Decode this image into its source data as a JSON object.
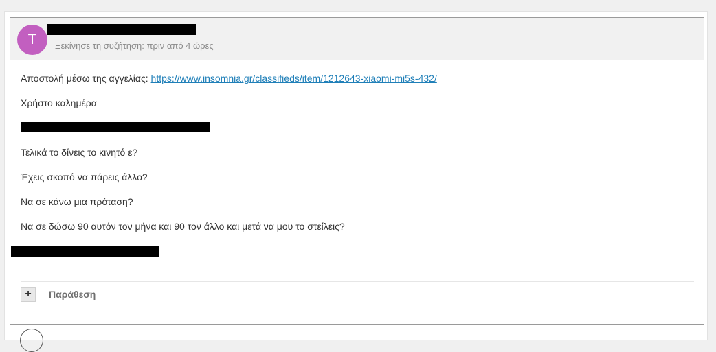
{
  "thread": {
    "author_initial": "T",
    "started_text": "Ξεκίνησε τη συζήτηση: πριν από 4 ώρες"
  },
  "message": {
    "lead": "Αποστολή μέσω της αγγελίας: ",
    "link": "https://www.insomnia.gr/classifieds/item/1212643-xiaomi-mi5s-432/",
    "lines": [
      "Χρήστο καλημέρα",
      "Τελικά το δίνεις το κινητό ε?",
      "Έχεις σκοπό να πάρεις άλλο?",
      "Να σε κάνω μια πρόταση?",
      "Να σε δώσω 90 αυτόν τον μήνα και 90 τον άλλο και μετά να μου το στείλεις?"
    ]
  },
  "actions": {
    "quote_icon": "+",
    "quote_label": "Παράθεση"
  }
}
